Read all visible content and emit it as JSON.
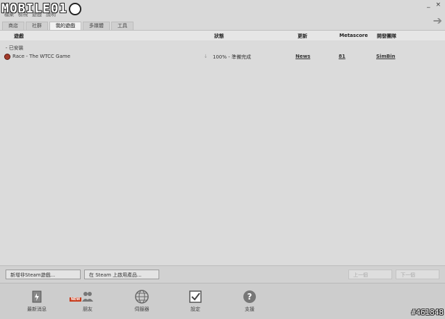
{
  "logo": {
    "text": "MOBILE01"
  },
  "menubar": {
    "items": [
      "檔案",
      "檢視",
      "遊戲",
      "說明"
    ]
  },
  "window": {
    "minimize": "_",
    "close": "×"
  },
  "tabs": [
    {
      "label": "商店",
      "active": false
    },
    {
      "label": "社群",
      "active": false
    },
    {
      "label": "我的遊戲",
      "active": true
    },
    {
      "label": "多媒體",
      "active": false
    },
    {
      "label": "工具",
      "active": false
    }
  ],
  "table": {
    "headers": {
      "game": "遊戲",
      "status": "狀態",
      "news": "更新",
      "metascore": "Metascore",
      "developer": "開發團隊"
    },
    "section_label": "- 已安裝",
    "rows": [
      {
        "name": "Race - The WTCC Game",
        "status": "100% - 準備完成",
        "news": "News",
        "metascore": "81",
        "developer": "SimBin"
      }
    ]
  },
  "bottom": {
    "add_game": "新增非Steam遊戲...",
    "activate": "在 Steam 上啟用產品...",
    "prev": "上一個",
    "next": "下一個"
  },
  "footer": {
    "items": [
      {
        "label": "最新消息",
        "icon": "news-icon"
      },
      {
        "label": "朋友",
        "icon": "friends-icon",
        "badge": "NEW"
      },
      {
        "label": "伺服器",
        "icon": "servers-icon"
      },
      {
        "label": "設定",
        "icon": "settings-icon"
      },
      {
        "label": "支援",
        "icon": "support-icon"
      }
    ]
  },
  "watermark": {
    "id": "#461848"
  }
}
